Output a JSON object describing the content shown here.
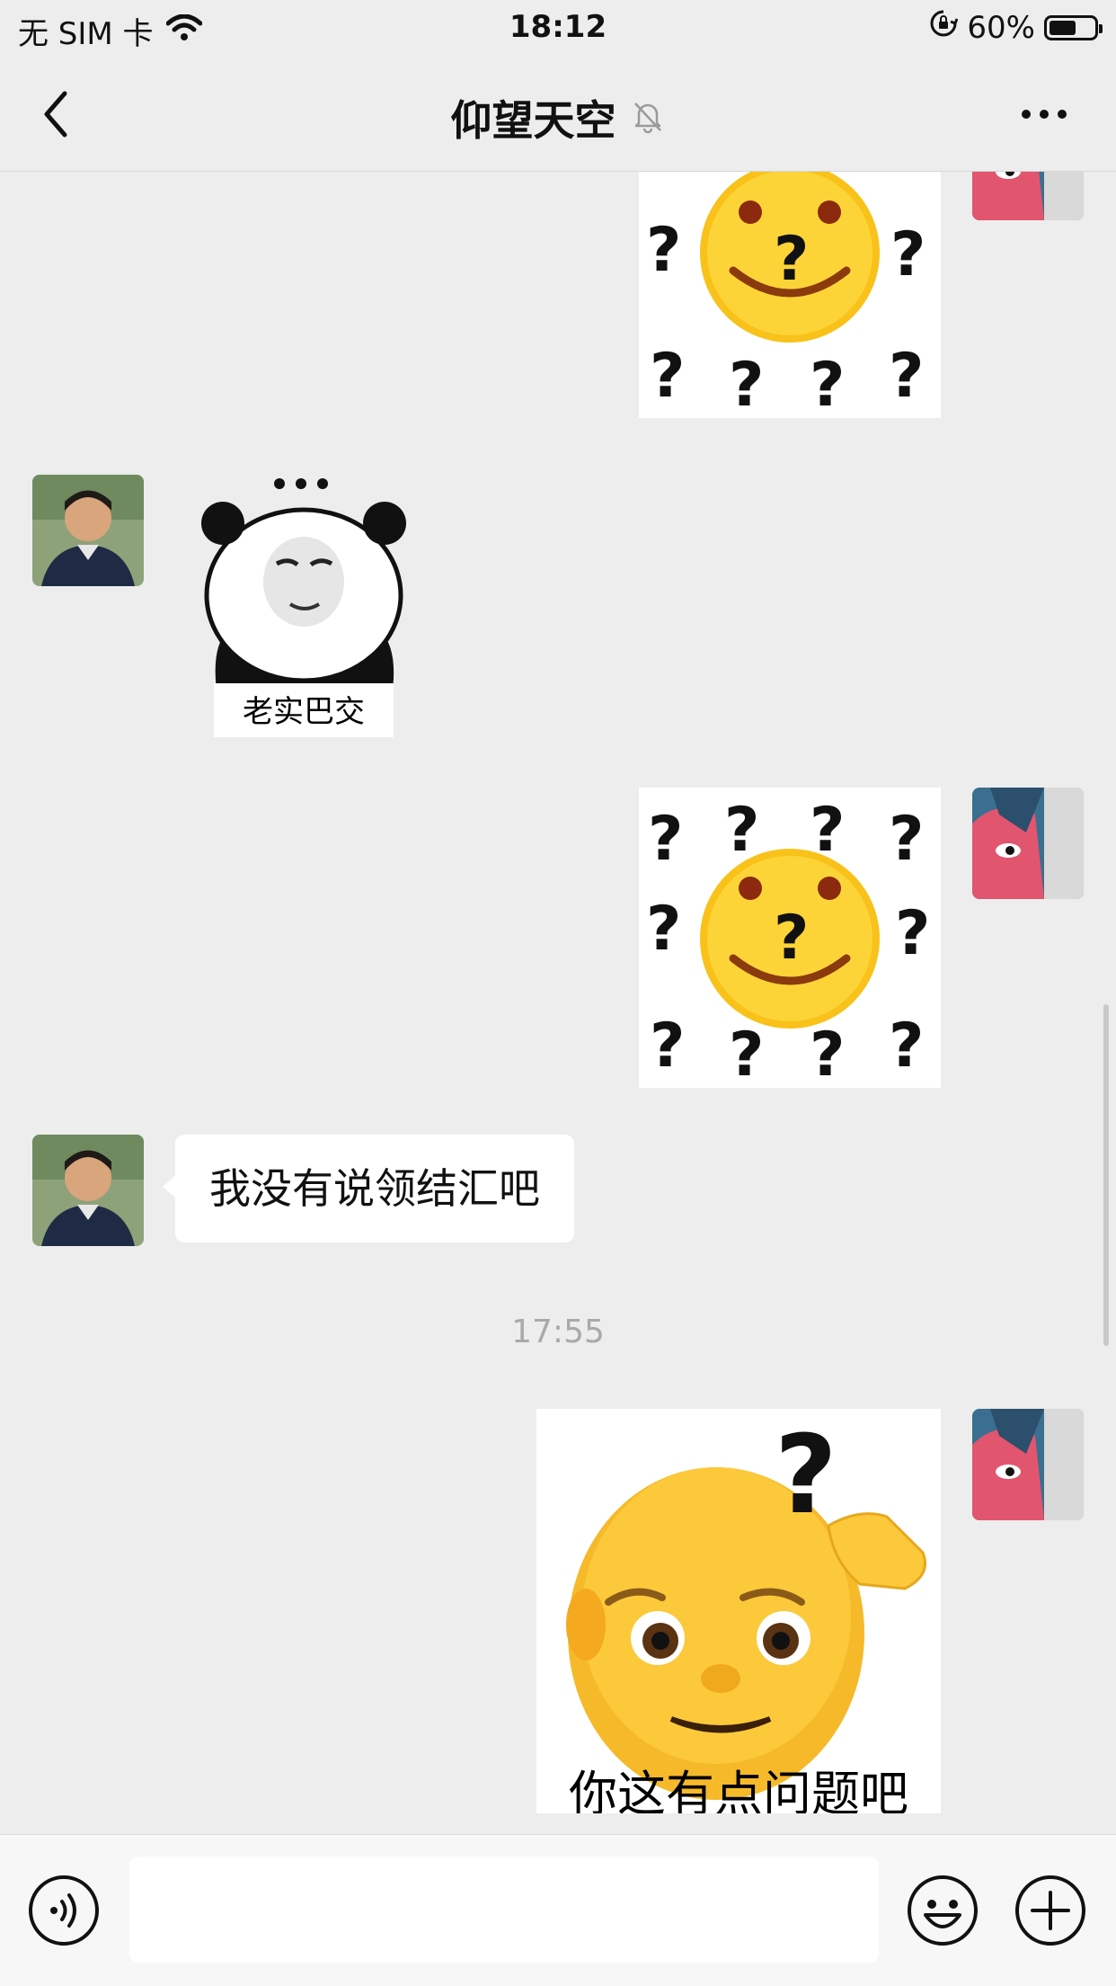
{
  "status_bar": {
    "carrier": "无 SIM 卡",
    "time": "18:12",
    "battery": "60%",
    "battery_level": 0.6
  },
  "nav": {
    "title": "仰望天空",
    "muted": true
  },
  "messages": [
    {
      "sender": "me",
      "type": "sticker",
      "sticker": "question-marks-smiley"
    },
    {
      "sender": "contact",
      "type": "sticker",
      "sticker": "panda-honest",
      "caption": "老实巴交"
    },
    {
      "sender": "me",
      "type": "sticker",
      "sticker": "question-marks-smiley"
    },
    {
      "sender": "contact",
      "type": "text",
      "text": "我没有说领结汇吧"
    },
    {
      "sender": "system",
      "type": "time",
      "text": "17:55"
    },
    {
      "sender": "me",
      "type": "sticker",
      "sticker": "old-man-thinking",
      "caption": "你这有点问题吧"
    }
  ],
  "input": {
    "value": "",
    "placeholder": ""
  },
  "colors": {
    "background": "#ededed",
    "bubble": "#ffffff",
    "timestamp": "#a9a9a9"
  }
}
